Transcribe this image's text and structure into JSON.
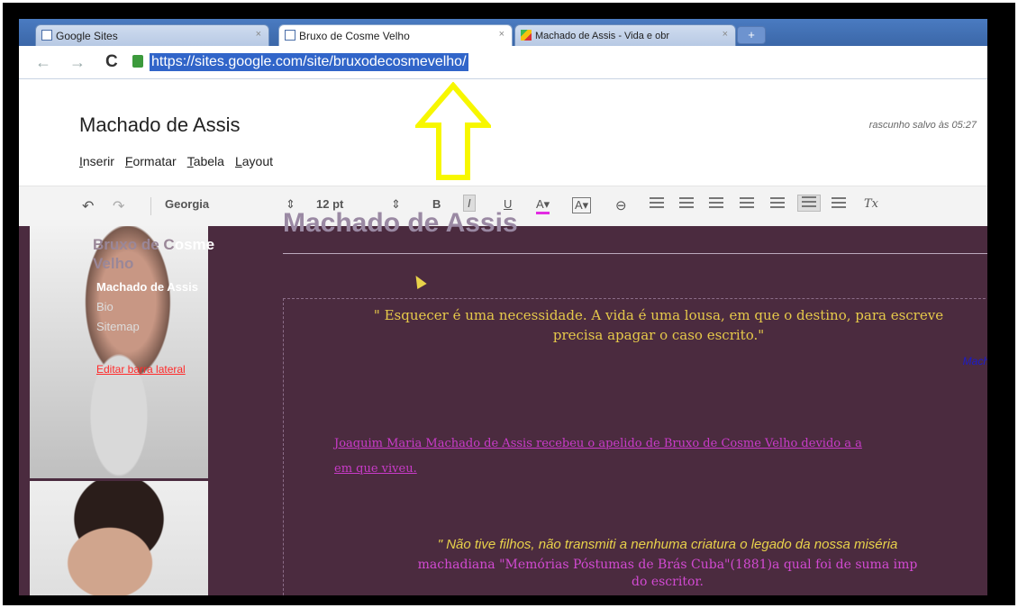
{
  "tabs": [
    {
      "label": "Google Sites",
      "close": "×"
    },
    {
      "label": "Bruxo de Cosme Velho",
      "close": "×"
    },
    {
      "label": "Machado de Assis - Vida e obr",
      "close": "×"
    }
  ],
  "new_tab_label": "+",
  "address": {
    "url": "https://sites.google.com/site/bruxodecosmevelho/"
  },
  "header": {
    "title": "Machado de Assis",
    "saved_status": "rascunho salvo às 05:27"
  },
  "menu": [
    "Inserir",
    "Formatar",
    "Tabela",
    "Layout"
  ],
  "toolbar": {
    "font": "Georgia",
    "size": "12 pt",
    "bold": "B",
    "italic": "I",
    "underline": "U"
  },
  "sidebar": {
    "title_line1": "Bruxo de C",
    "title_line1_b": "osme",
    "title_line2": "Velho",
    "links": [
      "Machado de Assis",
      "Bio",
      "Sitemap"
    ],
    "edit_link": "Editar barra lateral"
  },
  "page": {
    "heading": "Machado de Assis",
    "quote1_line1": "\" Esquecer é uma necessidade. A vida é uma lousa, em que o destino, para escreve",
    "quote1_line2": "precisa  apagar o caso escrito.\"",
    "quote1_author": "Mach",
    "paragraph_line1": "Joaquim Maria Machado de Assis recebeu o apelido de Bruxo de Cosme Velho devido a a",
    "paragraph_line2": "em que viveu.",
    "quote2_line1": "\" Não tive filhos, não transmiti a nenhuma criatura o legado da nossa miséria",
    "quote2_line2": "machadiana \"Memórias Póstumas de Brás Cuba\"(1881)a qual foi de suma imp",
    "quote2_line3": "do escritor."
  },
  "colors": {
    "accent_tab": "#3b67a8",
    "page_bg": "#4b2b3f",
    "arrow": "#f7f700",
    "quote": "#e6c94a"
  }
}
